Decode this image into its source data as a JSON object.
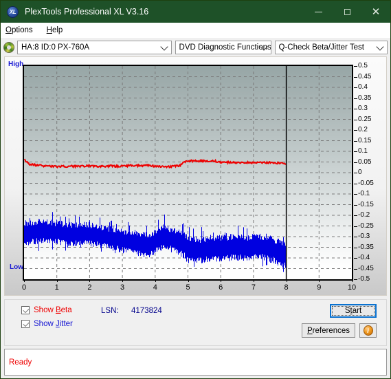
{
  "window": {
    "title": "PlexTools Professional XL V3.16",
    "icon": "xl-logo-icon",
    "minimize": "minimize-icon",
    "maximize": "maximize-icon",
    "close": "close-icon"
  },
  "menubar": {
    "items": [
      {
        "label": "Options",
        "accel": "O"
      },
      {
        "label": "Help",
        "accel": "H"
      }
    ]
  },
  "toolbar": {
    "drive_icon": "disc-icon",
    "device": "HA:8 ID:0  PX-760A",
    "function": "DVD Diagnostic Functions",
    "test": "Q-Check Beta/Jitter Test"
  },
  "controls": {
    "show_beta": {
      "label": "Show Beta",
      "accel": "B",
      "checked": true
    },
    "show_jitter": {
      "label": "Show Jitter",
      "accel": "J",
      "checked": true
    },
    "lsn_label": "LSN:",
    "lsn_value": "4173824",
    "start": "Start",
    "preferences": "Preferences",
    "info": "i"
  },
  "statusbar": {
    "text": "Ready"
  },
  "chart_data": {
    "type": "line",
    "title": "Q-Check Beta/Jitter Test",
    "xlabel": "",
    "ylabel": "",
    "xlim": [
      0,
      10
    ],
    "ylim": [
      -0.5,
      0.5
    ],
    "grid": true,
    "legend_position": "bottom-left",
    "left_axis_labels": {
      "top": "High",
      "bottom": "Low"
    },
    "xticks": [
      0,
      1,
      2,
      3,
      4,
      5,
      6,
      7,
      8,
      9,
      10
    ],
    "yticks": [
      0.5,
      0.45,
      0.4,
      0.35,
      0.3,
      0.25,
      0.2,
      0.15,
      0.1,
      0.05,
      0,
      -0.05,
      -0.1,
      -0.15,
      -0.2,
      -0.25,
      -0.3,
      -0.35,
      -0.4,
      -0.45,
      -0.5
    ],
    "data_end_x": 8,
    "cursor_line_x": 8,
    "colors": {
      "beta": "#ee0000",
      "jitter": "#0000e0",
      "axis_label": "#1414d2"
    },
    "series": [
      {
        "name": "Beta",
        "color": "#ee0000",
        "x": [
          0.0,
          0.16,
          0.33,
          0.49,
          0.65,
          0.82,
          0.98,
          1.14,
          1.31,
          1.47,
          1.63,
          1.8,
          1.96,
          2.12,
          2.29,
          2.45,
          2.61,
          2.78,
          2.94,
          3.1,
          3.27,
          3.43,
          3.59,
          3.76,
          3.92,
          4.08,
          4.24,
          4.41,
          4.57,
          4.73,
          4.9,
          5.06,
          5.22,
          5.39,
          5.55,
          5.71,
          5.88,
          6.04,
          6.2,
          6.37,
          6.53,
          6.69,
          6.86,
          7.02,
          7.18,
          7.35,
          7.51,
          7.67,
          7.84,
          8.0
        ],
        "values": [
          0.06,
          0.04,
          0.036,
          0.034,
          0.031,
          0.03,
          0.028,
          0.031,
          0.028,
          0.03,
          0.029,
          0.031,
          0.033,
          0.031,
          0.03,
          0.03,
          0.031,
          0.03,
          0.032,
          0.032,
          0.034,
          0.033,
          0.032,
          0.033,
          0.031,
          0.03,
          0.03,
          0.028,
          0.031,
          0.033,
          0.052,
          0.056,
          0.055,
          0.054,
          0.055,
          0.056,
          0.052,
          0.05,
          0.048,
          0.05,
          0.046,
          0.047,
          0.048,
          0.046,
          0.047,
          0.048,
          0.047,
          0.046,
          0.044,
          0.038
        ]
      },
      {
        "name": "Jitter",
        "color": "#0000e0",
        "x": [
          0.0,
          0.16,
          0.33,
          0.49,
          0.65,
          0.82,
          0.98,
          1.14,
          1.31,
          1.47,
          1.63,
          1.8,
          1.96,
          2.12,
          2.29,
          2.45,
          2.61,
          2.78,
          2.94,
          3.1,
          3.27,
          3.43,
          3.59,
          3.76,
          3.92,
          4.08,
          4.24,
          4.41,
          4.57,
          4.73,
          4.9,
          5.06,
          5.22,
          5.39,
          5.55,
          5.71,
          5.88,
          6.04,
          6.2,
          6.37,
          6.53,
          6.69,
          6.86,
          7.02,
          7.18,
          7.35,
          7.51,
          7.67,
          7.84,
          8.0
        ],
        "band_upper": [
          -0.245,
          -0.24,
          -0.238,
          -0.235,
          -0.238,
          -0.24,
          -0.243,
          -0.245,
          -0.248,
          -0.25,
          -0.25,
          -0.248,
          -0.25,
          -0.253,
          -0.258,
          -0.262,
          -0.268,
          -0.272,
          -0.276,
          -0.28,
          -0.284,
          -0.288,
          -0.292,
          -0.296,
          -0.292,
          -0.272,
          -0.262,
          -0.268,
          -0.276,
          -0.286,
          -0.3,
          -0.312,
          -0.318,
          -0.32,
          -0.318,
          -0.314,
          -0.312,
          -0.31,
          -0.308,
          -0.306,
          -0.308,
          -0.31,
          -0.308,
          -0.305,
          -0.304,
          -0.306,
          -0.312,
          -0.322,
          -0.334,
          -0.346
        ],
        "band_lower": [
          -0.33,
          -0.322,
          -0.318,
          -0.314,
          -0.316,
          -0.318,
          -0.32,
          -0.322,
          -0.324,
          -0.326,
          -0.325,
          -0.324,
          -0.326,
          -0.33,
          -0.334,
          -0.338,
          -0.344,
          -0.35,
          -0.356,
          -0.362,
          -0.368,
          -0.374,
          -0.378,
          -0.38,
          -0.374,
          -0.352,
          -0.342,
          -0.35,
          -0.358,
          -0.37,
          -0.386,
          -0.398,
          -0.404,
          -0.406,
          -0.404,
          -0.4,
          -0.398,
          -0.396,
          -0.394,
          -0.392,
          -0.394,
          -0.396,
          -0.394,
          -0.392,
          -0.39,
          -0.394,
          -0.4,
          -0.412,
          -0.424,
          -0.436
        ]
      }
    ]
  }
}
